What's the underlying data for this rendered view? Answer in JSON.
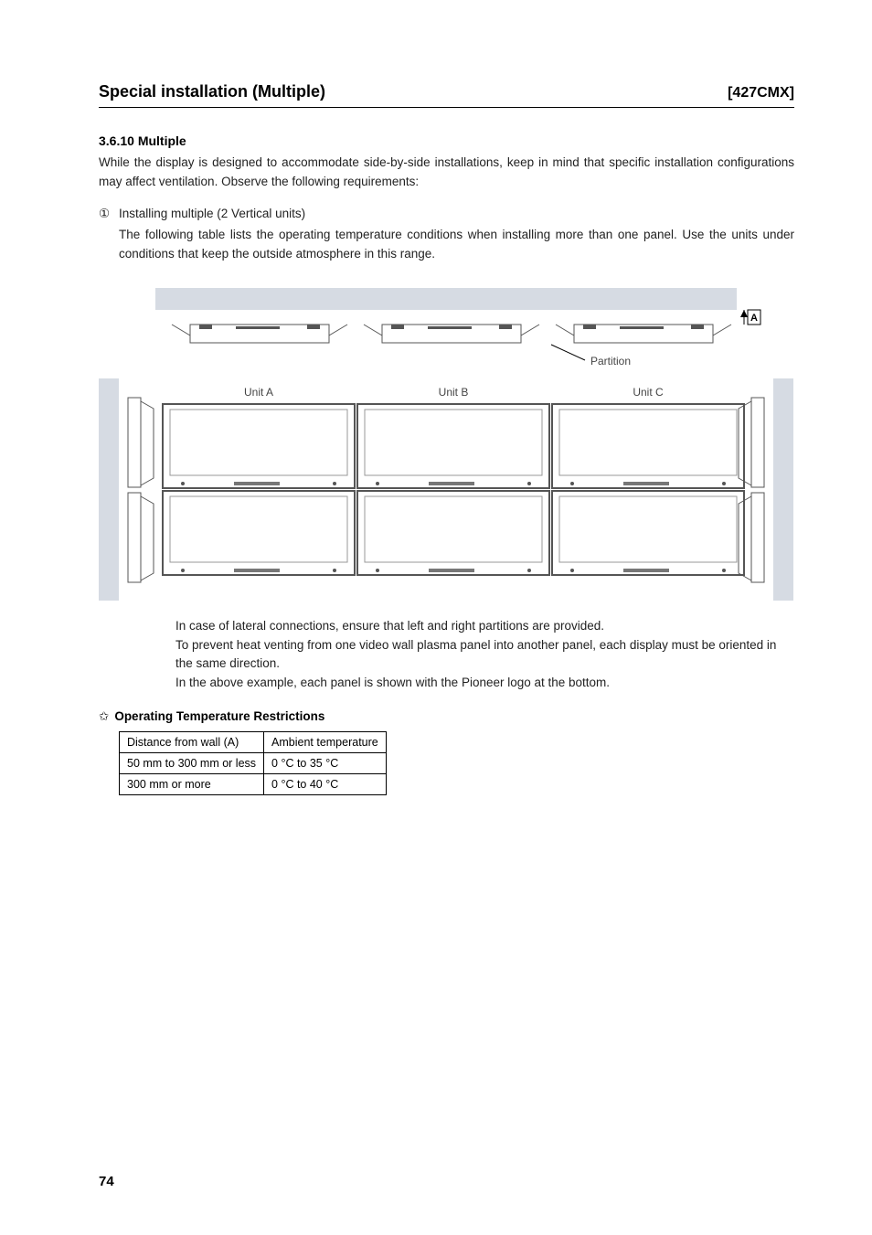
{
  "header": {
    "left": "Special installation (Multiple)",
    "right": "[427CMX]"
  },
  "section": {
    "number_title": "3.6.10 Multiple",
    "intro": "While the display is designed to accommodate side-by-side installations, keep in mind that specific installation configurations may affect ventilation. Observe the following requirements:",
    "list_num": "①",
    "list_title": "Installing multiple (2 Vertical units)",
    "list_body": "The following table lists the operating temperature conditions when installing more than one panel. Use the units under conditions that keep the outside atmosphere in this range."
  },
  "diagram": {
    "labelA": "A",
    "partition": "Partition",
    "unitA": "Unit A",
    "unitB": "Unit B",
    "unitC": "Unit C"
  },
  "notes": {
    "n1": "In case of lateral connections, ensure that left and right partitions are provided.",
    "n2": "To prevent heat venting from one video wall plasma panel into another panel, each display must be oriented in the same direction.",
    "n3": "In the above example, each panel is shown with the Pioneer logo at the bottom."
  },
  "temp_heading": "Operating Temperature Restrictions",
  "temp_table": {
    "h1": "Distance from wall (A)",
    "h2": "Ambient temperature",
    "r1c1": "50 mm to 300 mm or less",
    "r1c2": "0 °C to 35 °C",
    "r2c1": "300 mm or more",
    "r2c2": "0 °C to 40 °C"
  },
  "page": "74"
}
